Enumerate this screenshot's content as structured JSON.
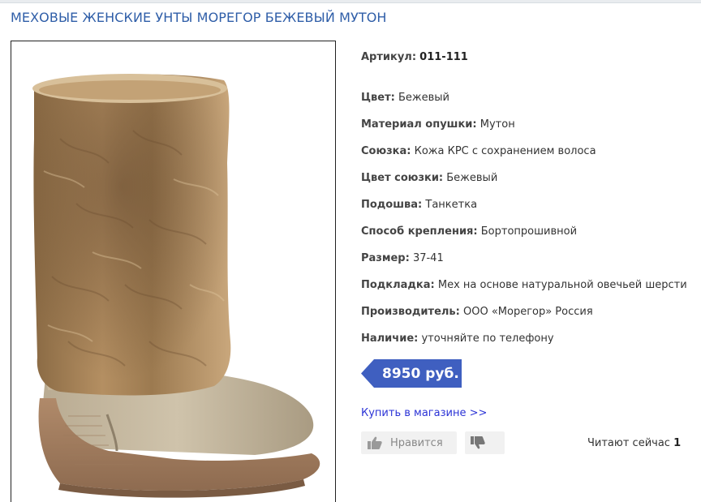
{
  "page": {
    "title": "МЕХОВЫЕ ЖЕНСКИЕ УНТЫ МОРЕГОР БЕЖЕВЫЙ МУТОН"
  },
  "product": {
    "image_alt": "boot-photo",
    "properties": [
      {
        "key": "Артикул:",
        "value": "011-111"
      },
      {
        "key": "Цвет:",
        "value": "Бежевый"
      },
      {
        "key": "Материал опушки:",
        "value": "Мутон"
      },
      {
        "key": "Союзка:",
        "value": "Кожа КРС с сохранением волоса"
      },
      {
        "key": "Цвет союзки:",
        "value": "Бежевый"
      },
      {
        "key": "Подошва:",
        "value": "Танкетка"
      },
      {
        "key": "Способ крепления:",
        "value": "Бортопрошивной"
      },
      {
        "key": "Размер:",
        "value": "37-41"
      },
      {
        "key": "Подкладка:",
        "value": "Мех на основе натуральной овечьей шерсти"
      },
      {
        "key": "Производитель:",
        "value": "ООО «Морегор» Россия"
      },
      {
        "key": "Наличие:",
        "value": "уточняйте по телефону"
      }
    ],
    "price": "8950 руб.",
    "buy_link": "Купить в магазине >>"
  },
  "social": {
    "like_label": "Нравится",
    "like_icon": "thumbs-up-icon",
    "dislike_icon": "thumbs-down-icon",
    "reading_label": "Читают сейчас",
    "reading_count": "1"
  },
  "colors": {
    "title": "#2f5ea8",
    "price_bg": "#3f5fc0",
    "link": "#2b33d6"
  }
}
